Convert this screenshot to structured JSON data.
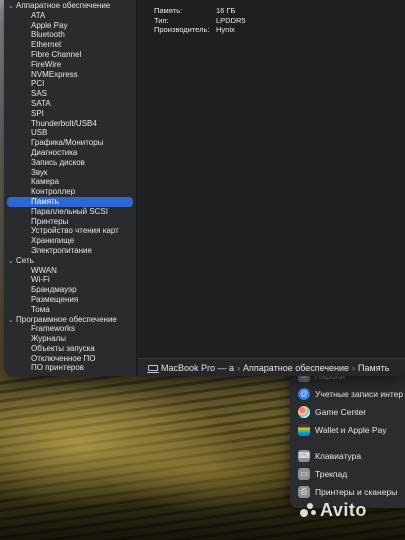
{
  "sidebar": {
    "hardware": {
      "label": "Аппаратное обеспечение",
      "items": [
        "ATA",
        "Apple Pay",
        "Bluetooth",
        "Ethernet",
        "Fibre Channel",
        "FireWire",
        "NVMExpress",
        "PCI",
        "SAS",
        "SATA",
        "SPI",
        "Thunderbolt/USB4",
        "USB",
        "Графика/Мониторы",
        "Диагностика",
        "Запись дисков",
        "Звук",
        "Камера",
        "Контроллер",
        "Память",
        "Параллельный SCSI",
        "Принтеры",
        "Устройство чтения карт",
        "Хранилище",
        "Электропитание"
      ],
      "selected": "Память"
    },
    "network": {
      "label": "Сеть",
      "items": [
        "WWAN",
        "Wi-Fi",
        "Брандмауэр",
        "Размещения",
        "Тома"
      ]
    },
    "software": {
      "label": "Программное обеспечение",
      "items": [
        "Frameworks",
        "Журналы",
        "Объекты запуска",
        "Отключенное ПО",
        "ПО принтеров"
      ]
    }
  },
  "details": {
    "rows": [
      {
        "label": "Память:",
        "value": "16 ГБ"
      },
      {
        "label": "Тип:",
        "value": "LPDDR5"
      },
      {
        "label": "Производитель:",
        "value": "Hynix"
      }
    ]
  },
  "pathbar": {
    "computer": "MacBook Pro — a",
    "category": "Аппаратное обеспечение",
    "item": "Память",
    "separator": "›"
  },
  "settings_panel": {
    "items": [
      {
        "label": "Пароли",
        "icon": "key-icon",
        "color": "#8e8e93",
        "faded": true
      },
      {
        "label": "Учетные записи интер",
        "icon": "at-icon",
        "color": "#2f7cf6"
      },
      {
        "label": "Game Center",
        "icon": "game-center-icon",
        "color": "#c7c7cc"
      },
      {
        "label": "Wallet и Apple Pay",
        "icon": "wallet-icon",
        "color": "#e0e0e0"
      },
      {
        "label": "Клавиатура",
        "icon": "keyboard-icon",
        "color": "#9a9aa0"
      },
      {
        "label": "Трекпад",
        "icon": "trackpad-icon",
        "color": "#9a9aa0"
      },
      {
        "label": "Принтеры и сканеры",
        "icon": "printer-icon",
        "color": "#9a9aa0"
      }
    ]
  },
  "watermark": {
    "text": "Avito"
  },
  "colors": {
    "selection": "#2f66d0",
    "sidebar_bg": "#2a2b2e",
    "content_bg": "#1e1f21"
  }
}
